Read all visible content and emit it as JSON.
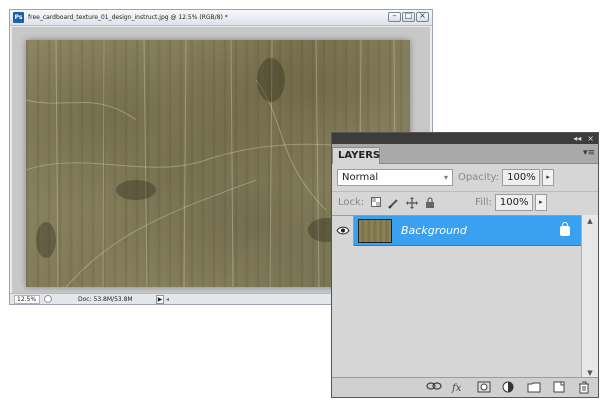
{
  "document": {
    "title": "free_cardboard_texture_01_design_instruct.jpg @ 12.5% (RGB/8) *",
    "app_badge": "Ps",
    "zoom": "12.5%",
    "doc_info": "Doc: 53.8M/53.8M",
    "info_arrow": "▶",
    "scroll_arrow": "◂",
    "minimize": "–",
    "restore": "□",
    "close": "×"
  },
  "layers_panel": {
    "collapse_glyph": "◂◂",
    "close_glyph": "×",
    "tab_label": "LAYERS",
    "menu_glyph": "▾≡",
    "blend_mode": "Normal",
    "blend_caret": "▾",
    "opacity_label": "Opacity:",
    "opacity_value": "100%",
    "fill_label": "Fill:",
    "fill_value": "100%",
    "spin_glyph": "▸",
    "lock_label": "Lock:",
    "layers": [
      {
        "name": "Background",
        "visible": true,
        "locked": true,
        "selected": true
      }
    ],
    "scroll_up": "▲",
    "scroll_down": "▼"
  },
  "colors": {
    "selection": "#3aa0f0",
    "panel_bg": "#d6d6d6",
    "canvas_bg": "#c8c8c8"
  },
  "icons": {
    "lock_transparent": "checkerboard-icon",
    "lock_paint": "brush-icon",
    "lock_move": "move-icon",
    "lock_all": "padlock-icon",
    "bottom": [
      "link-icon",
      "fx-icon",
      "mask-icon",
      "adjustment-icon",
      "folder-icon",
      "new-layer-icon",
      "trash-icon"
    ]
  }
}
